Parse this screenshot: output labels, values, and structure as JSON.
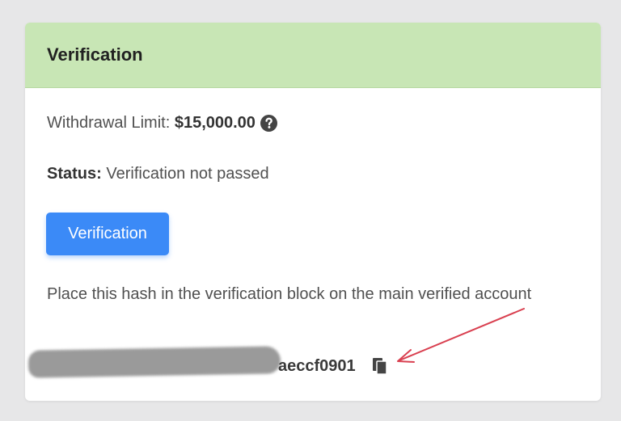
{
  "card": {
    "title": "Verification"
  },
  "withdrawal": {
    "label": "Withdrawal Limit:",
    "value": "$15,000.00",
    "help_icon": "question-circle-icon"
  },
  "status": {
    "label": "Status:",
    "value": "Verification not passed"
  },
  "verify_button": {
    "label": "Verification"
  },
  "instruction": {
    "text": "Place this hash in the verification block on the main verified account"
  },
  "hash": {
    "visible_suffix": "aeccf0901",
    "copy_icon": "copy-icon"
  },
  "colors": {
    "header_bg": "#c8e6b5",
    "button_bg": "#3b8af7",
    "arrow": "#d94050",
    "redaction": "#9a9a9a"
  }
}
